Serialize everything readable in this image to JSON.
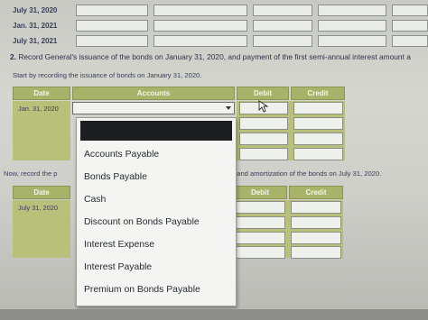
{
  "top_rows": [
    {
      "date": "July 31, 2020"
    },
    {
      "date": "Jan. 31, 2021"
    },
    {
      "date": "July 31, 2021"
    }
  ],
  "question": {
    "number": "2.",
    "text": "Record General's issuance of the bonds on January 31, 2020, and payment of the first semi-annual interest amount a"
  },
  "instruction1": "Start by recording the issuance of bonds on January 31, 2020.",
  "table1": {
    "headers": {
      "date": "Date",
      "accounts": "Accounts",
      "debit": "Debit",
      "credit": "Credit"
    },
    "first_date": "Jan. 31, 2020"
  },
  "instruction2": "Now, record the p",
  "instruction2_tail": "t and amortization of the bonds on July 31, 2020.",
  "table2": {
    "headers": {
      "date": "Date",
      "debit": "Debit",
      "credit": "Credit"
    },
    "first_date": "July 31, 2020"
  },
  "dropdown": {
    "options": [
      "Accounts Payable",
      "Bonds Payable",
      "Cash",
      "Discount on Bonds Payable",
      "Interest Expense",
      "Interest Payable",
      "Premium on Bonds Payable"
    ]
  },
  "colors": {
    "header_green": "#a8b36a",
    "text_navy": "#3a3d5a"
  }
}
